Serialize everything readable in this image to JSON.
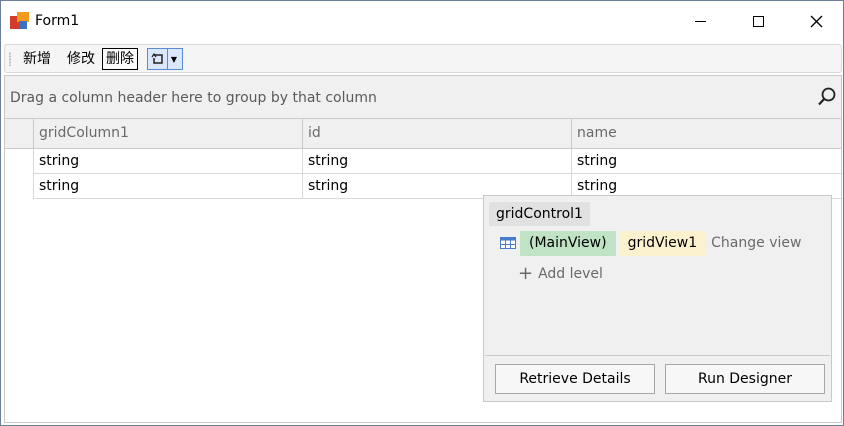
{
  "window": {
    "title": "Form1"
  },
  "toolbar": {
    "add_label": "新增",
    "edit_label": "修改",
    "delete_label": "删除"
  },
  "group_panel": {
    "text": "Drag a column header here to group by that column"
  },
  "grid": {
    "columns": [
      "gridColumn1",
      "id",
      "name"
    ],
    "rows": [
      [
        "string",
        "string",
        "string"
      ],
      [
        "string",
        "string",
        "string"
      ]
    ]
  },
  "designer": {
    "control_name": "gridControl1",
    "main_view_label": "(MainView)",
    "view_name": "gridView1",
    "change_view_label": "Change view",
    "add_level_label": "Add level",
    "retrieve_details_label": "Retrieve Details",
    "run_designer_label": "Run Designer"
  },
  "colors": {
    "main_view_bg": "#bfe3c4",
    "view_name_bg": "#fcf1cf",
    "combo_bg": "#dbe8fb"
  },
  "icons": {
    "app": "app-logo-icon",
    "minimize": "minimize-icon",
    "maximize": "maximize-icon",
    "close": "close-icon",
    "search": "search-icon",
    "combo": "refresh-icon",
    "grid_view": "grid-view-icon",
    "add": "plus-icon"
  }
}
